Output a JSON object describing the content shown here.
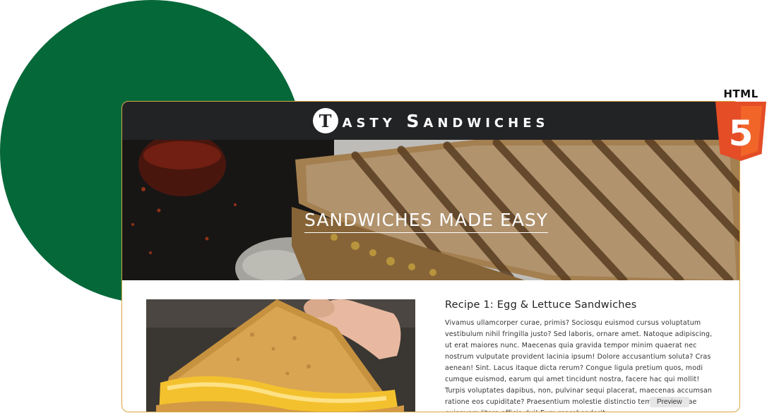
{
  "badge": {
    "label": "HTML",
    "glyph": "5",
    "icon": "html5-shield-icon",
    "color": "#e44d26"
  },
  "site": {
    "logo_letter": "T",
    "title": "asty Sandwiches",
    "header_color": "#222325"
  },
  "hero": {
    "title": "SANDWICHES MADE EASY"
  },
  "recipe": {
    "title": "Recipe 1: Egg & Lettuce Sandwiches",
    "body": "Vivamus ullamcorper curae, primis? Sociosqu euismod cursus voluptatum vestibulum nihil fringilla justo? Sed laboris, ornare amet. Natoque adipiscing, ut erat maiores nunc. Maecenas quia gravida tempor minim quaerat nec nostrum vulputate provident lacinia ipsum! Dolore accusantium soluta? Cras aenean! Sint. Lacus itaque dicta rerum? Congue ligula pretium quos, modi cumque euismod, earum qui amet tincidunt nostra, facere hac qui mollit! Turpis voluptates dapibus, non, pulvinar sequi placerat, maecenas accumsan ratione eos cupiditate? Praesentium molestie distinctio temporibus quae quisquam litora officia dui! Eum reprehenderit"
  },
  "preview": {
    "label": "Preview"
  },
  "colors": {
    "circle": "#056839",
    "frame_border": "#d9a441"
  }
}
